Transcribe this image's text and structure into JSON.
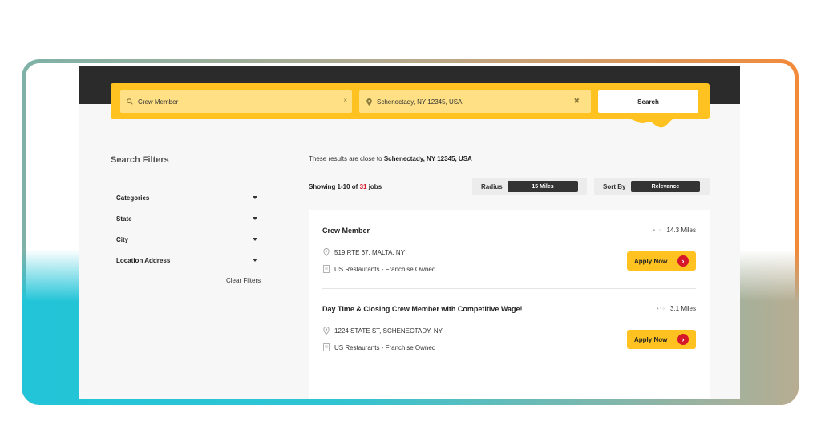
{
  "search": {
    "keyword_value": "Crew Member",
    "location_value": "Schenectady, NY 12345, USA",
    "button_label": "Search",
    "clear_glyph_small": "×",
    "clear_glyph": "✖"
  },
  "filters": {
    "title": "Search Filters",
    "items": [
      {
        "label": "Categories"
      },
      {
        "label": "State"
      },
      {
        "label": "City"
      },
      {
        "label": "Location Address"
      }
    ],
    "clear_label": "Clear Filters"
  },
  "results_header": {
    "close_to_prefix": "These results are close to ",
    "close_to_location": "Schenectady, NY 12345, USA",
    "showing_prefix": "Showing 1-10 of ",
    "showing_count": "31",
    "showing_suffix": " jobs",
    "radius_label": "Radius",
    "radius_value": "15 Miles",
    "sort_label": "Sort By",
    "sort_value": "Relevance"
  },
  "jobs": [
    {
      "title": "Crew Member",
      "distance": "14.3 Miles",
      "address": "519 RTE 67, MALTA, NY",
      "company": "US Restaurants - Franchise Owned",
      "apply_label": "Apply Now"
    },
    {
      "title": "Day Time & Closing Crew Member with Competitive Wage!",
      "distance": "3.1 Miles",
      "address": "1224 STATE ST, SCHENECTADY, NY",
      "company": "US Restaurants - Franchise Owned",
      "apply_label": "Apply Now"
    }
  ],
  "colors": {
    "accent_yellow": "#ffc220",
    "accent_red": "#d6172a",
    "header_dark": "#2b2b2b"
  },
  "icons": {
    "search": "search-icon",
    "location": "location-pin-icon",
    "clear": "clear-icon",
    "dropdown": "chevron-down-icon",
    "building": "building-icon",
    "arrow": "chevron-right-icon"
  }
}
